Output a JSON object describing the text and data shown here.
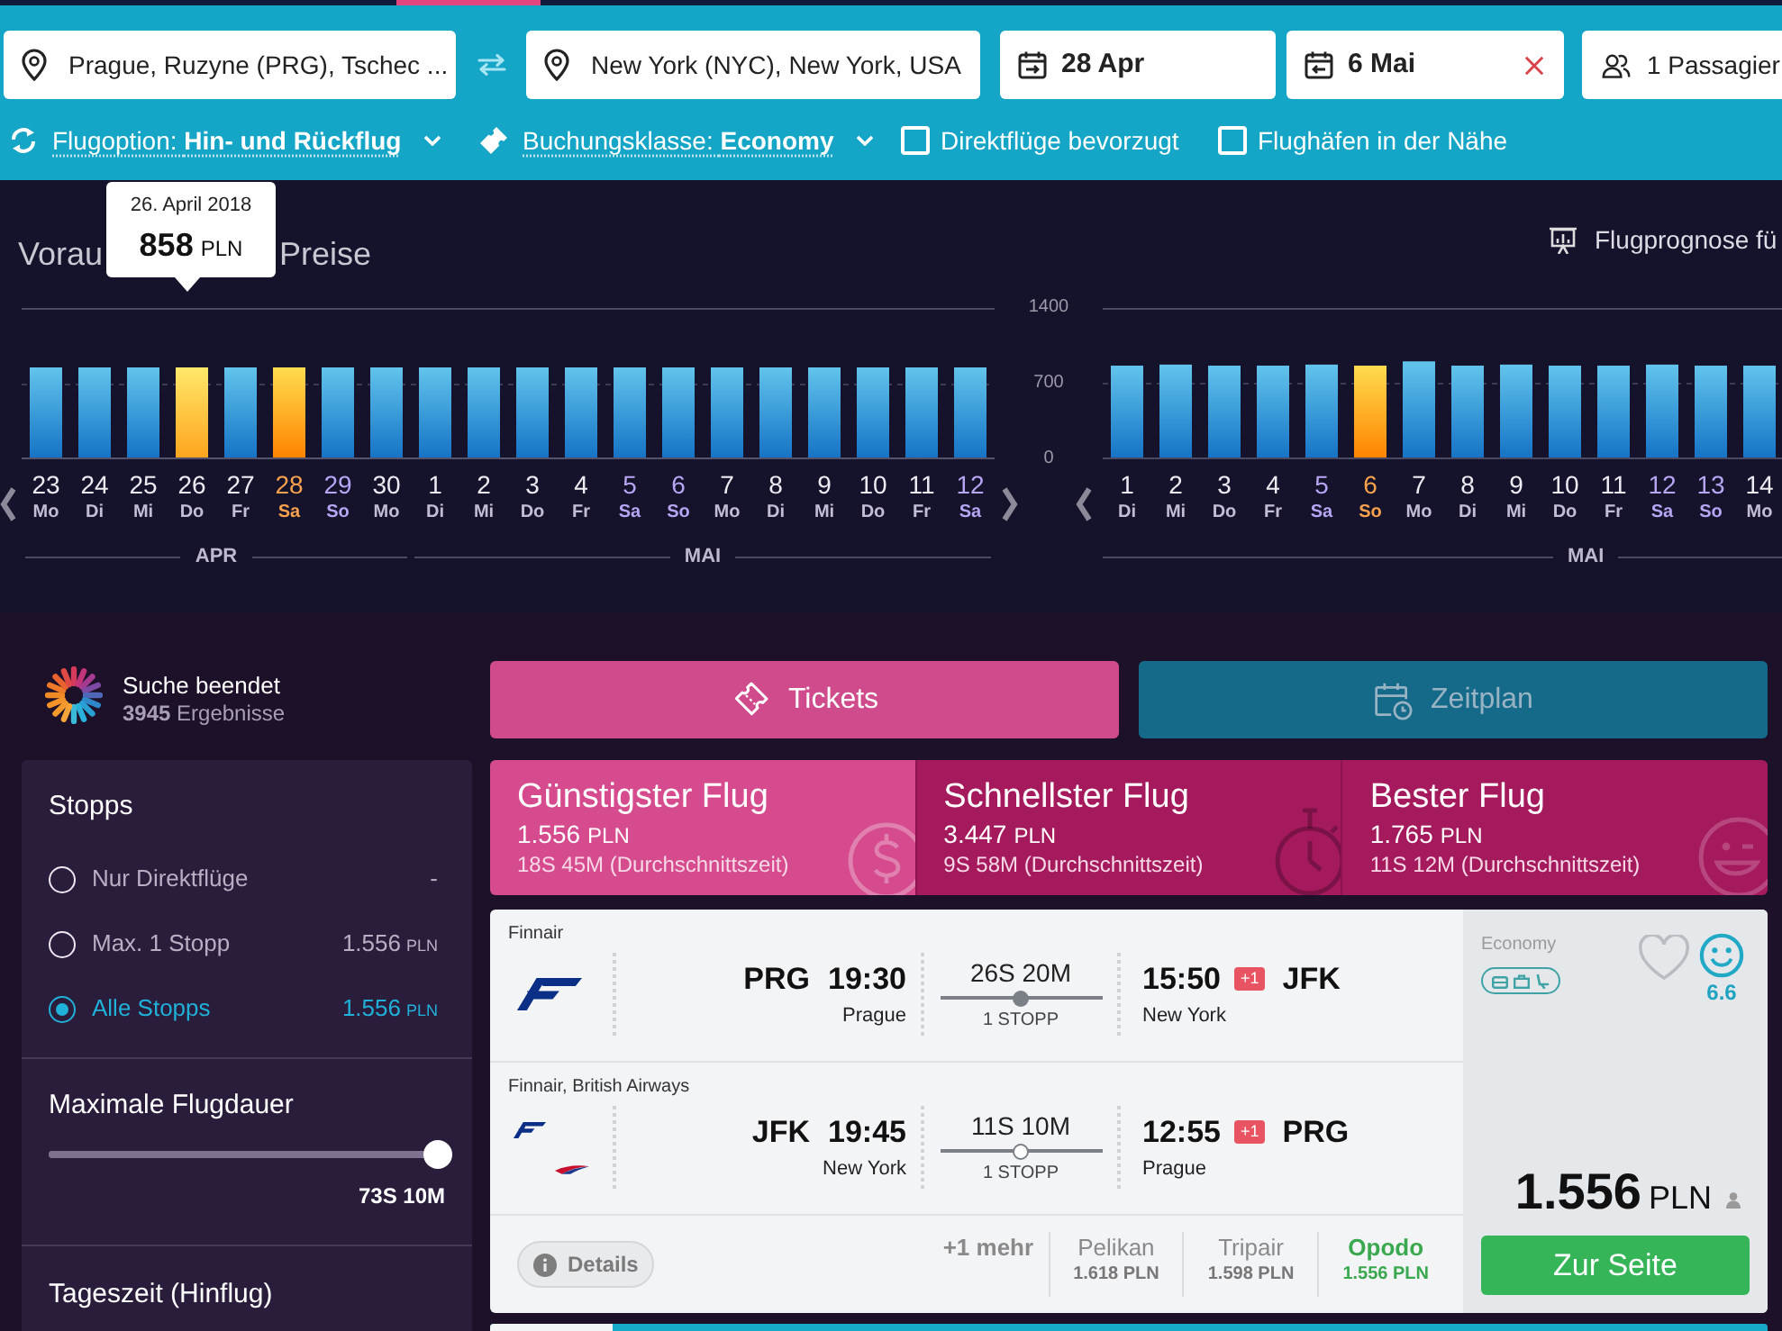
{
  "search": {
    "origin": {
      "value": "Prague, Ruzyne (PRG), Tschec ..."
    },
    "destination": {
      "value": "New York (NYC), New York, USA"
    },
    "departure_date": {
      "value": "28 Apr"
    },
    "return_date": {
      "value": "6 Mai"
    },
    "passengers": {
      "value": "1 Passagier"
    }
  },
  "options": [
    {
      "kind": "trip_type",
      "label": "Flugoption: **Hin- und Rückflug**"
    },
    {
      "kind": "cabin_class",
      "label": "Buchungsklasse: **Economy**"
    },
    {
      "kind": "checkbox",
      "label": "Direktflüge bevorzugt",
      "checked": false
    },
    {
      "kind": "checkbox",
      "label": "Flughäfen in der Nähe",
      "checked": false
    }
  ],
  "forecast": {
    "title_start": "Vorau",
    "title_end": "Preise",
    "tooltip": {
      "date": "26. April 2018",
      "price": "858",
      "currency": "PLN"
    },
    "link": "Flugprognose fü",
    "outbound": {
      "months": [
        {
          "label": "APR",
          "days": [
            {
              "day": "23",
              "weekday": "Mo",
              "weekend": false,
              "selected": false,
              "hovered": false
            },
            {
              "day": "24",
              "weekday": "Di",
              "weekend": false,
              "selected": false,
              "hovered": false
            },
            {
              "day": "25",
              "weekday": "Mi",
              "weekend": false,
              "selected": false,
              "hovered": false
            },
            {
              "day": "26",
              "weekday": "Do",
              "weekend": false,
              "selected": false,
              "hovered": true
            },
            {
              "day": "27",
              "weekday": "Fr",
              "weekend": false,
              "selected": false,
              "hovered": false
            },
            {
              "day": "28",
              "weekday": "Sa",
              "weekend": true,
              "selected": true,
              "hovered": false
            },
            {
              "day": "29",
              "weekday": "So",
              "weekend": true,
              "selected": false,
              "hovered": false
            },
            {
              "day": "30",
              "weekday": "Mo",
              "weekend": false,
              "selected": false,
              "hovered": false
            }
          ]
        },
        {
          "label": "MAI",
          "days": [
            {
              "day": "1",
              "weekday": "Di",
              "weekend": false,
              "selected": false,
              "hovered": false
            },
            {
              "day": "2",
              "weekday": "Mi",
              "weekend": false,
              "selected": false,
              "hovered": false
            },
            {
              "day": "3",
              "weekday": "Do",
              "weekend": false,
              "selected": false,
              "hovered": false
            },
            {
              "day": "4",
              "weekday": "Fr",
              "weekend": false,
              "selected": false,
              "hovered": false
            },
            {
              "day": "5",
              "weekday": "Sa",
              "weekend": true,
              "selected": false,
              "hovered": false
            },
            {
              "day": "6",
              "weekday": "So",
              "weekend": true,
              "selected": false,
              "hovered": false
            },
            {
              "day": "7",
              "weekday": "Mo",
              "weekend": false,
              "selected": false,
              "hovered": false
            },
            {
              "day": "8",
              "weekday": "Di",
              "weekend": false,
              "selected": false,
              "hovered": false
            },
            {
              "day": "9",
              "weekday": "Mi",
              "weekend": false,
              "selected": false,
              "hovered": false
            },
            {
              "day": "10",
              "weekday": "Do",
              "weekend": false,
              "selected": false,
              "hovered": false
            },
            {
              "day": "11",
              "weekday": "Fr",
              "weekend": false,
              "selected": false,
              "hovered": false
            },
            {
              "day": "12",
              "weekday": "Sa",
              "weekend": true,
              "selected": false,
              "hovered": false
            }
          ]
        }
      ]
    },
    "return": {
      "month": "MAI",
      "days": [
        {
          "weekday": "Di",
          "weekend": false,
          "selected": false
        },
        {
          "weekday": "Mi",
          "weekend": false,
          "selected": false
        },
        {
          "weekday": "Do",
          "weekend": false,
          "selected": false
        },
        {
          "weekday": "Fr",
          "weekend": false,
          "selected": false
        },
        {
          "weekday": "Sa",
          "weekend": true,
          "selected": false
        },
        {
          "weekday": "So",
          "weekend": true,
          "selected": true
        },
        {
          "weekday": "Mo",
          "weekend": false,
          "selected": false
        },
        {
          "weekday": "Di",
          "weekend": false,
          "selected": false
        },
        {
          "weekday": "Mi",
          "weekend": false,
          "selected": false
        },
        {
          "weekday": "Do",
          "weekend": false,
          "selected": false
        },
        {
          "weekday": "Fr",
          "weekend": false,
          "selected": false
        },
        {
          "weekday": "Sa",
          "weekend": true,
          "selected": false
        },
        {
          "weekday": "So",
          "weekend": true,
          "selected": false
        },
        {
          "weekday": "Mo",
          "weekend": false,
          "selected": false
        }
      ],
      "chart_data": {
        "type": "bar",
        "categories": [
          "1",
          "2",
          "3",
          "4",
          "5",
          "6",
          "7",
          "8",
          "9",
          "10",
          "11",
          "12",
          "13",
          "14"
        ],
        "series": [
          {
            "values": [
              860,
              870,
              860,
              860,
              870,
              860,
              900,
              860,
              870,
              860,
              860,
              870,
              860,
              860
            ]
          }
        ],
        "ylim": [
          0,
          1400
        ],
        "yticks": [
          0,
          700,
          1400
        ]
      }
    }
  },
  "status": {
    "title": "Suche beendet",
    "results": "**3945** Ergebnisse"
  },
  "filters": {
    "stops": {
      "title": "Stopps",
      "options": [
        {
          "label": "Nur Direktflüge",
          "price": "-",
          "selected": false
        },
        {
          "label": "Max. 1 Stopp",
          "price": "1.556",
          "currency": "PLN",
          "selected": false
        },
        {
          "label": "Alle Stopps",
          "price": "1.556",
          "currency": "PLN",
          "selected": true
        }
      ]
    },
    "duration": {
      "title": "Maximale Flugdauer",
      "level": 1,
      "reading": "73S 10M"
    },
    "time_of_day": {
      "title": "Tageszeit (Hinflug)"
    }
  },
  "view_tabs": [
    {
      "kind": "tickets",
      "label": "Tickets",
      "selected": true
    },
    {
      "kind": "schedule",
      "label": "Zeitplan",
      "selected": false
    }
  ],
  "sort_options": [
    {
      "kind": "cheapest",
      "title": "Günstigster Flug",
      "price": "1.556",
      "currency": "PLN",
      "duration": "18S 45M (Durchschnittszeit)",
      "selected": true
    },
    {
      "kind": "fastest",
      "title": "Schnellster Flug",
      "price": "3.447",
      "currency": "PLN",
      "duration": "9S 58M (Durchschnittszeit)",
      "selected": false
    },
    {
      "kind": "best",
      "title": "Bester Flug",
      "price": "1.765",
      "currency": "PLN",
      "duration": "11S 12M (Durchschnittszeit)",
      "selected": false
    }
  ],
  "results": [
    {
      "legs": [
        {
          "airlines": "Finnair",
          "logos": [
            {
              "kind": "finnair"
            }
          ],
          "from": {
            "code": "PRG",
            "time": "19:30",
            "city": "Prague"
          },
          "duration": "26S 20M",
          "stop_dot_filled": true,
          "stops": "1 STOPP",
          "to": {
            "time": "15:50",
            "day_offset": "+1",
            "code": "JFK",
            "city": "New York"
          }
        },
        {
          "airlines": "Finnair, British Airways",
          "logos": [
            {
              "kind": "finnair"
            },
            {
              "kind": "british_airways"
            }
          ],
          "from": {
            "code": "JFK",
            "time": "19:45",
            "city": "New York"
          },
          "duration": "11S 10M",
          "stop_dot_filled": false,
          "stops": "1 STOPP",
          "to": {
            "time": "12:55",
            "day_offset": "+1",
            "code": "PRG",
            "city": "Prague"
          }
        }
      ],
      "details": "Details",
      "more": "+1 mehr",
      "providers": [
        {
          "name": "Pelikan",
          "price": "1.618 PLN",
          "best": false
        },
        {
          "name": "Tripair",
          "price": "1.598 PLN",
          "best": false
        },
        {
          "name": "Opodo",
          "price": "1.556 PLN",
          "best": true
        }
      ],
      "cabin": "Economy",
      "favorite": false,
      "rating": "6.6",
      "price": "1.556",
      "currency": "PLN",
      "button": "Zur Seite"
    }
  ]
}
